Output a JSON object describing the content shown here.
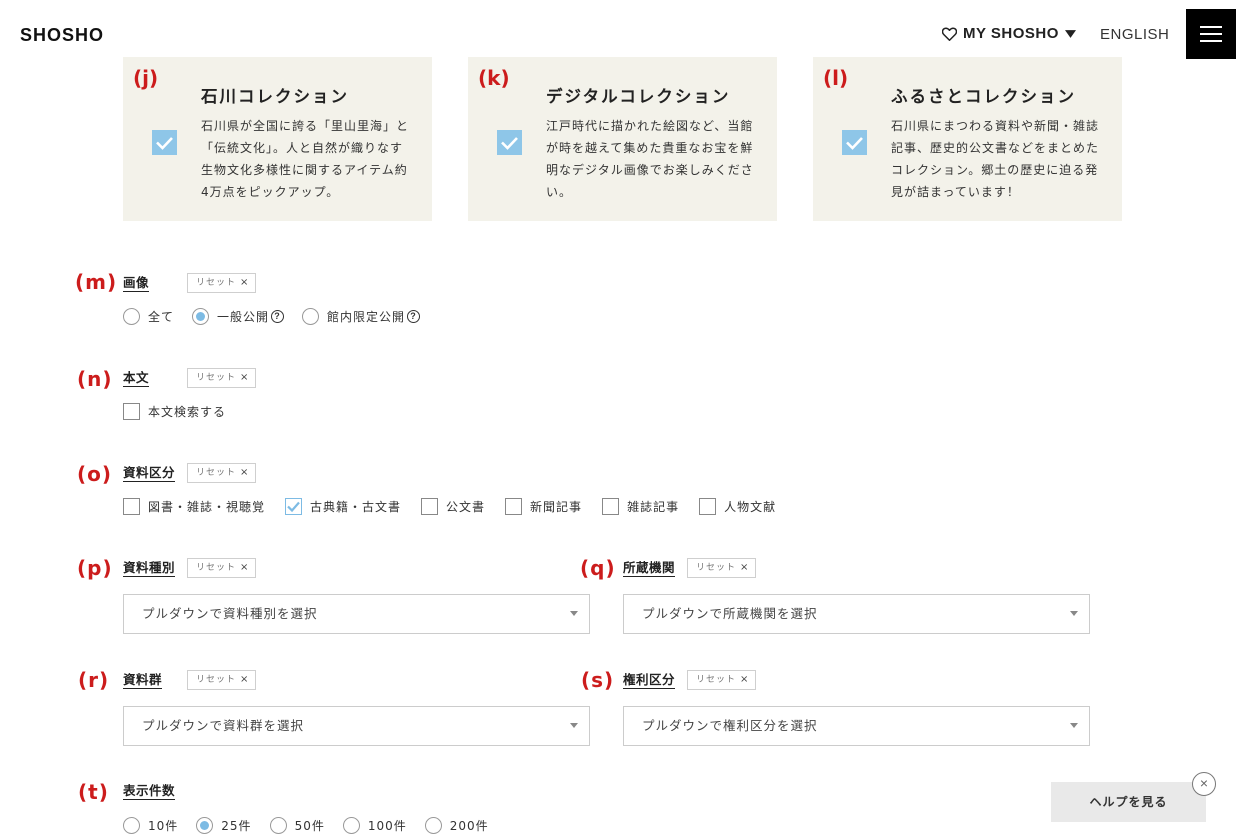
{
  "header": {
    "logo": "SHOSHO",
    "my_shosho": "MY SHOSHO",
    "english": "ENGLISH"
  },
  "collections": [
    {
      "marker": "(j)",
      "title": "石川コレクション",
      "desc": "石川県が全国に誇る「里山里海」と「伝統文化」。人と自然が織りなす生物文化多様性に関するアイテム約4万点をピックアップ。",
      "checked": true
    },
    {
      "marker": "(k)",
      "title": "デジタルコレクション",
      "desc": "江戸時代に描かれた絵図など、当館が時を越えて集めた貴重なお宝を鮮明なデジタル画像でお楽しみください。",
      "checked": true
    },
    {
      "marker": "(l)",
      "title": "ふるさとコレクション",
      "desc": "石川県にまつわる資料や新聞・雑誌記事、歴史的公文書などをまとめたコレクション。郷土の歴史に迫る発見が詰まっています！",
      "checked": true
    }
  ],
  "reset_label": "リセット",
  "reset_x": "×",
  "image": {
    "marker": "(m)",
    "label": "画像",
    "options": [
      {
        "label": "全て",
        "selected": false
      },
      {
        "label": "一般公開",
        "selected": true,
        "help": "?"
      },
      {
        "label": "館内限定公開",
        "selected": false,
        "help": "?"
      }
    ]
  },
  "fulltext": {
    "marker": "(n)",
    "label": "本文",
    "option": "本文検索する",
    "checked": false
  },
  "material_class": {
    "marker": "(o)",
    "label": "資料区分",
    "options": [
      {
        "label": "図書・雑誌・視聴覚",
        "checked": false
      },
      {
        "label": "古典籍・古文書",
        "checked": true
      },
      {
        "label": "公文書",
        "checked": false
      },
      {
        "label": "新聞記事",
        "checked": false
      },
      {
        "label": "雑誌記事",
        "checked": false
      },
      {
        "label": "人物文献",
        "checked": false
      }
    ]
  },
  "material_type": {
    "marker": "(p)",
    "label": "資料種別",
    "placeholder": "プルダウンで資料種別を選択"
  },
  "holding_org": {
    "marker": "(q)",
    "label": "所蔵機関",
    "placeholder": "プルダウンで所蔵機関を選択"
  },
  "material_group": {
    "marker": "(r)",
    "label": "資料群",
    "placeholder": "プルダウンで資料群を選択"
  },
  "rights": {
    "marker": "(s)",
    "label": "権利区分",
    "placeholder": "プルダウンで権利区分を選択"
  },
  "display_count": {
    "marker": "(t)",
    "label": "表示件数",
    "options": [
      {
        "label": "10件",
        "selected": false
      },
      {
        "label": "25件",
        "selected": true
      },
      {
        "label": "50件",
        "selected": false
      },
      {
        "label": "100件",
        "selected": false
      },
      {
        "label": "200件",
        "selected": false
      }
    ]
  },
  "help": {
    "label": "ヘルプを見る",
    "close": "×"
  },
  "colors": {
    "accent_red": "#cc1c1c",
    "check_blue": "#8ec6e8",
    "card_bg": "#f3f2ea"
  },
  "icons": {
    "favorite": "heart-icon",
    "dropdown": "caret-down-icon",
    "menu": "hamburger-icon"
  }
}
